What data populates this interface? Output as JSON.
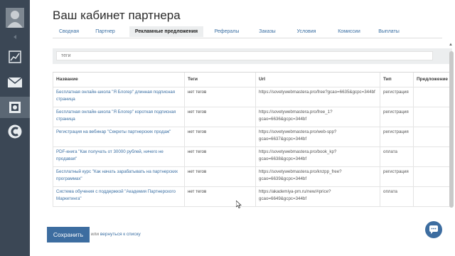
{
  "page_title": "Ваш кабинет партнера",
  "tabs": [
    {
      "label": "Сводная"
    },
    {
      "label": "Партнер"
    },
    {
      "label": "Рекламные предложения"
    },
    {
      "label": "Рефералы"
    },
    {
      "label": "Заказы"
    },
    {
      "label": "Условия"
    },
    {
      "label": "Комиссии"
    },
    {
      "label": "Выплаты"
    }
  ],
  "search": {
    "placeholder": "теги"
  },
  "table": {
    "headers": {
      "name": "Название",
      "tags": "Теги",
      "url": "Url",
      "type": "Тип",
      "offer": "Предложение"
    },
    "rows": [
      {
        "name": "Бесплатная онлайн-школа \"Я Блогер\" длинная подписная страница",
        "tags": "нет тегов",
        "url": "https://sovetywebmastera.pro/free?gcao=6635&gcpc=344bf",
        "type": "регистрация"
      },
      {
        "name": "Бесплатная онлайн-школа \"Я Блогер\" короткая подписная страница",
        "tags": "нет тегов",
        "url": "https://sovetywebmastera.pro/free_1?gcao=6636&gcpc=344bf",
        "type": "регистрация"
      },
      {
        "name": "Регистрация на вебинар \"Секреты партнерских продаж\"",
        "tags": "нет тегов",
        "url": "https://sovetywebmastera.pro/web-spp?gcao=6637&gcpc=344bf",
        "type": "регистрация"
      },
      {
        "name": "PDF-книга \"Как получать от 30000 рублей, ничего не продавая\"",
        "tags": "нет тегов",
        "url": "https://sovetywebmastera.pro/book_kp?gcao=6638&gcpc=344bf",
        "type": "оплата"
      },
      {
        "name": "Бесплатный курс \"Как начать зарабатывать на партнерских программах\"",
        "tags": "нет тегов",
        "url": "https://sovetywebmastera.pro/knzpp_free?gcao=6639&gcpc=344bf",
        "type": "регистрация"
      },
      {
        "name": "Система обучения с поддержкой \"Академия Партнерского Маркетинга\"",
        "tags": "нет тегов",
        "url": "https://akademiya-pm.ru/new/#price?gcao=6649&gcpc=344bf",
        "type": "оплата"
      }
    ]
  },
  "footer": {
    "save_label": "Сохранить",
    "or_text": "или ",
    "back_label": "вернуться к списку"
  },
  "colors": {
    "sidebar": "#3b4755",
    "accent": "#3d6da0",
    "link": "#3a6fa3"
  },
  "icons": [
    "user-avatar-icon",
    "collapse-arrow-icon",
    "chart-icon",
    "mail-icon",
    "safe-icon",
    "gc-logo-icon",
    "chat-icon"
  ]
}
